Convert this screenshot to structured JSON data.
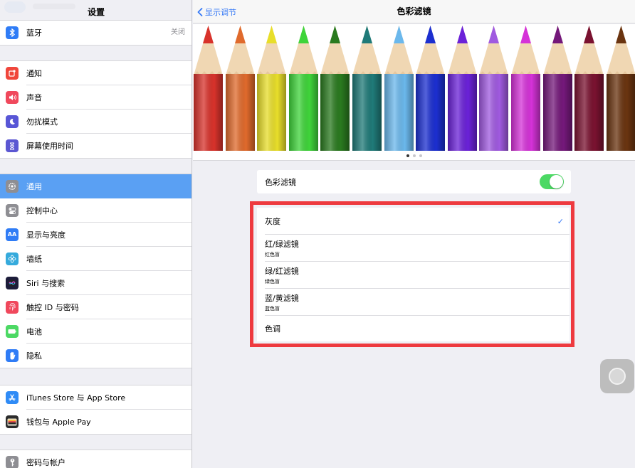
{
  "sidebar": {
    "title": "设置",
    "bluetooth": {
      "label": "蓝牙",
      "value": "关闭",
      "icon": "bluetooth-icon",
      "color": "#2f7cf6"
    },
    "group_notifications": [
      {
        "label": "通知",
        "icon": "notifications-icon",
        "color": "#f0463b"
      },
      {
        "label": "声音",
        "icon": "sound-icon",
        "color": "#f0485c"
      },
      {
        "label": "勿扰模式",
        "icon": "moon-icon",
        "color": "#5856d6"
      },
      {
        "label": "屏幕使用时间",
        "icon": "hourglass-icon",
        "color": "#5b57d2"
      }
    ],
    "group_general": [
      {
        "label": "通用",
        "icon": "gear-icon",
        "color": "#8e8e93",
        "selected": true
      },
      {
        "label": "控制中心",
        "icon": "toggles-icon",
        "color": "#8e8e93"
      },
      {
        "label": "显示与亮度",
        "icon": "text-size-icon",
        "color": "#2f7cf6"
      },
      {
        "label": "墙纸",
        "icon": "flower-icon",
        "color": "#35aadc"
      },
      {
        "label": "Siri 与搜索",
        "icon": "siri-icon",
        "color": "#1c1c3a"
      },
      {
        "label": "触控 ID 与密码",
        "icon": "fingerprint-icon",
        "color": "#f0485c"
      },
      {
        "label": "电池",
        "icon": "battery-icon",
        "color": "#4cd964"
      },
      {
        "label": "隐私",
        "icon": "hand-icon",
        "color": "#2f7cf6"
      }
    ],
    "group_store": [
      {
        "label": "iTunes Store 与 App Store",
        "icon": "app-store-icon",
        "color": "#2f8bf6"
      },
      {
        "label": "钱包与 Apple Pay",
        "icon": "wallet-icon",
        "color": "#2b2b2b"
      }
    ],
    "group_accounts": [
      {
        "label": "密码与帐户",
        "icon": "key-icon",
        "color": "#8e8e93"
      }
    ]
  },
  "navbar": {
    "back_label": "显示调节",
    "title": "色彩滤镜"
  },
  "pencil_colors": [
    "#d8322b",
    "#e06a2c",
    "#e8de2a",
    "#3fd43a",
    "#2a7a1f",
    "#1f7a78",
    "#6bb8ec",
    "#1c2fd0",
    "#6b22d8",
    "#a05ae0",
    "#d532d8",
    "#74187a",
    "#7a1230",
    "#6a3410"
  ],
  "pager": {
    "count": 3,
    "active": 0
  },
  "color_filters_toggle": {
    "label": "色彩滤镜",
    "on": true,
    "color": "#4cd964"
  },
  "filters": [
    {
      "title": "灰度",
      "subtitle": "",
      "checked": true
    },
    {
      "title": "红/绿滤镜",
      "subtitle": "红色盲",
      "checked": false
    },
    {
      "title": "绿/红滤镜",
      "subtitle": "绿色盲",
      "checked": false
    },
    {
      "title": "蓝/黄滤镜",
      "subtitle": "蓝色盲",
      "checked": false
    },
    {
      "title": "色调",
      "subtitle": "",
      "checked": false
    }
  ],
  "check_mark": "✓",
  "highlight_color": "#ee3a3f"
}
